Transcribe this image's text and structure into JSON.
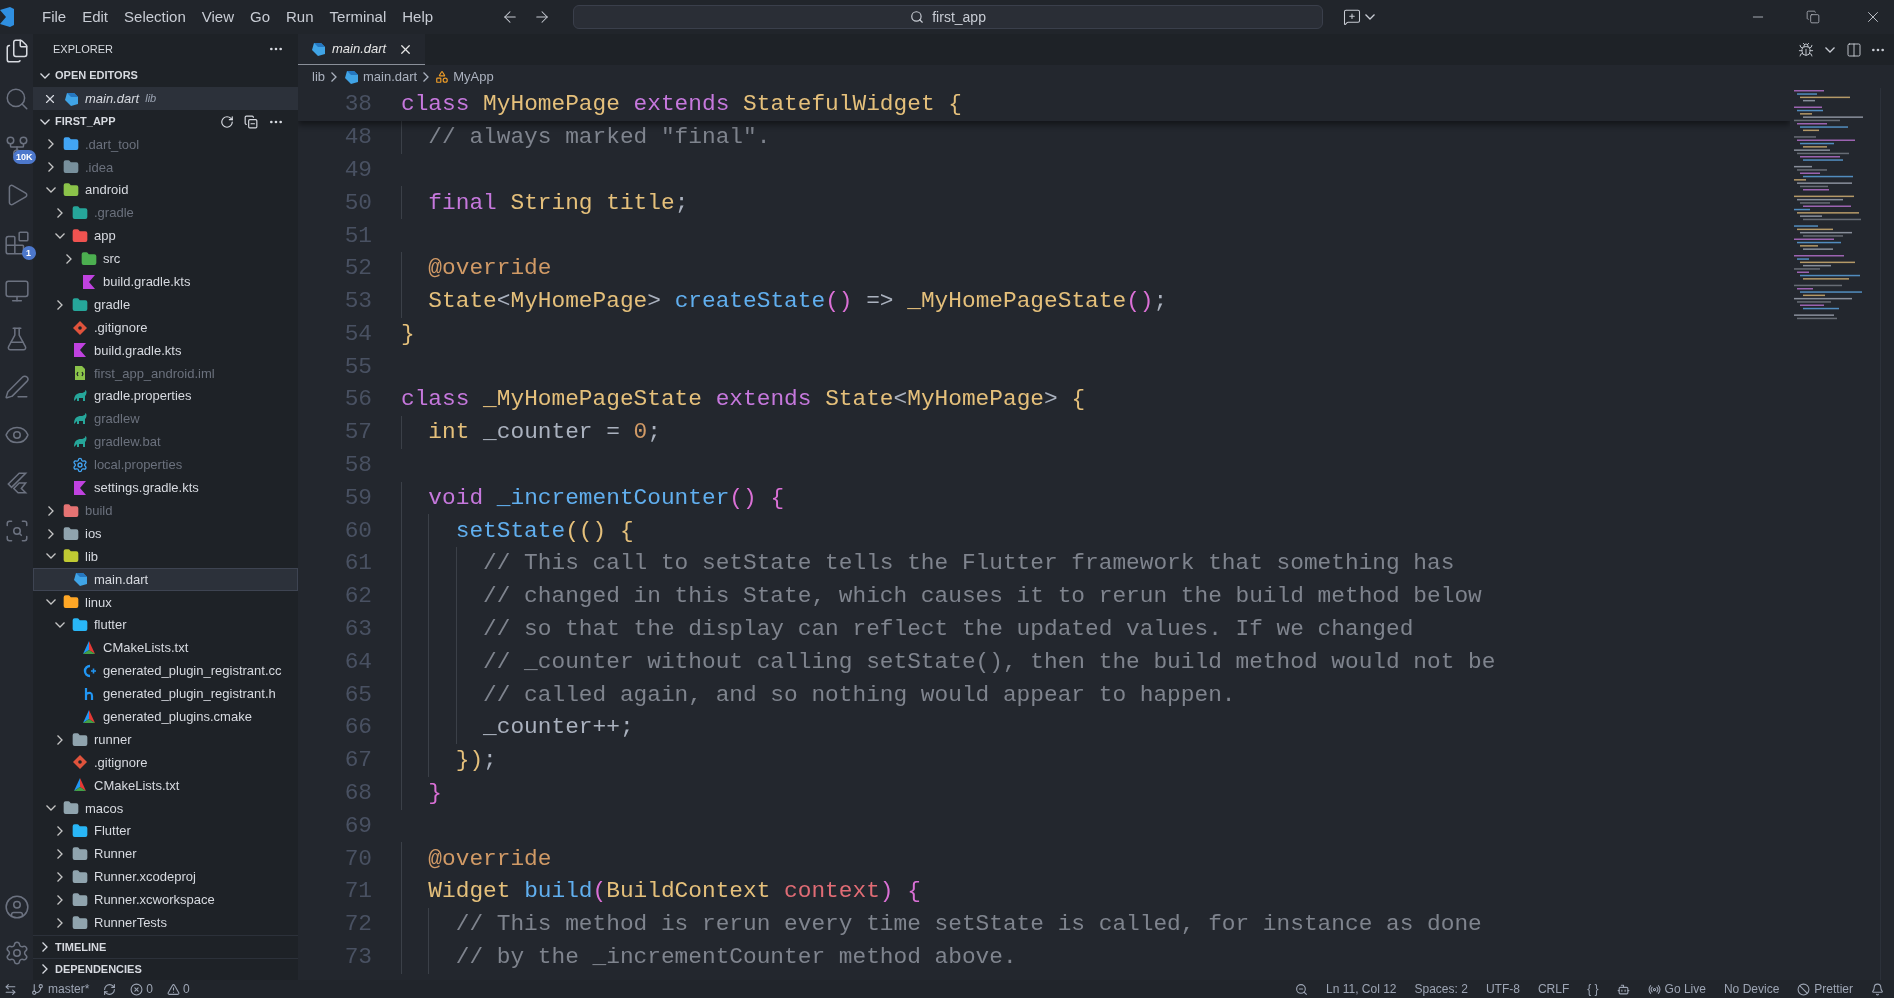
{
  "title_bar": {
    "menus": [
      "File",
      "Edit",
      "Selection",
      "View",
      "Go",
      "Run",
      "Terminal",
      "Help"
    ],
    "search": "first_app"
  },
  "activity_bar": {
    "items": [
      {
        "kind": "explorer",
        "selected": true
      },
      {
        "kind": "search",
        "selected": false
      },
      {
        "kind": "source_control",
        "selected": false,
        "badge": "10K"
      },
      {
        "kind": "run",
        "selected": false
      },
      {
        "kind": "extensions",
        "selected": false,
        "badge": "1"
      },
      {
        "kind": "remote",
        "selected": false
      },
      {
        "kind": "testing",
        "selected": false
      },
      {
        "kind": "pen",
        "selected": false
      },
      {
        "kind": "preview",
        "selected": false
      },
      {
        "kind": "flutter",
        "selected": false
      },
      {
        "kind": "scan",
        "selected": false
      }
    ],
    "bottom": [
      {
        "kind": "account"
      },
      {
        "kind": "settings"
      }
    ]
  },
  "sidebar": {
    "title": "EXPLORER",
    "open_editors": {
      "label": "OPEN EDITORS",
      "expanded": true,
      "items": [
        {
          "name": "main.dart",
          "description": "lib",
          "kind": "dart"
        }
      ]
    },
    "project": {
      "label": "FIRST_APP",
      "expanded": true,
      "tree": [
        {
          "name": ".dart_tool",
          "kind": "folder",
          "color": "#42a5f5",
          "expanded": false,
          "selected": false,
          "dimmed": true
        },
        {
          "name": ".idea",
          "kind": "folder",
          "color": "#78909c",
          "expanded": false,
          "selected": false,
          "dimmed": true
        },
        {
          "name": "android",
          "kind": "folder",
          "color": "#8bc34a",
          "expanded": true,
          "selected": false,
          "dimmed": false,
          "children": [
            {
              "name": ".gradle",
              "kind": "folder",
              "color": "#26a69a",
              "expanded": false,
              "selected": false,
              "dimmed": true
            },
            {
              "name": "app",
              "kind": "folder",
              "color": "#ef5350",
              "expanded": true,
              "selected": false,
              "dimmed": false,
              "children": [
                {
                  "name": "src",
                  "kind": "folder",
                  "color": "#4caf50",
                  "expanded": false,
                  "selected": false,
                  "dimmed": false
                },
                {
                  "name": "build.gradle.kts",
                  "kind": "kotlin",
                  "selected": false,
                  "dimmed": false
                }
              ]
            },
            {
              "name": "gradle",
              "kind": "folder",
              "color": "#26a69a",
              "expanded": false,
              "selected": false,
              "dimmed": false
            },
            {
              "name": ".gitignore",
              "kind": "git",
              "selected": false,
              "dimmed": false
            },
            {
              "name": "build.gradle.kts",
              "kind": "kotlin",
              "selected": false,
              "dimmed": false
            },
            {
              "name": "first_app_android.iml",
              "kind": "iml",
              "selected": false,
              "dimmed": true
            },
            {
              "name": "gradle.properties",
              "kind": "gradle",
              "selected": false,
              "dimmed": false
            },
            {
              "name": "gradlew",
              "kind": "gradle",
              "selected": false,
              "dimmed": true
            },
            {
              "name": "gradlew.bat",
              "kind": "gradle",
              "selected": false,
              "dimmed": true
            },
            {
              "name": "local.properties",
              "kind": "gear",
              "selected": false,
              "dimmed": true
            },
            {
              "name": "settings.gradle.kts",
              "kind": "kotlin",
              "selected": false,
              "dimmed": false
            }
          ]
        },
        {
          "name": "build",
          "kind": "folder",
          "color": "#e57373",
          "expanded": false,
          "selected": false,
          "dimmed": true
        },
        {
          "name": "ios",
          "kind": "folder",
          "color": "#90a4ae",
          "expanded": false,
          "selected": false,
          "dimmed": false
        },
        {
          "name": "lib",
          "kind": "folder",
          "color": "#c0ca33",
          "expanded": true,
          "selected": false,
          "dimmed": false,
          "children": [
            {
              "name": "main.dart",
              "kind": "dart",
              "selected": true,
              "dimmed": false
            }
          ]
        },
        {
          "name": "linux",
          "kind": "folder",
          "color": "#ffa726",
          "expanded": true,
          "selected": false,
          "dimmed": false,
          "children": [
            {
              "name": "flutter",
              "kind": "folder",
              "color": "#29b6f6",
              "expanded": true,
              "selected": false,
              "dimmed": false,
              "children": [
                {
                  "name": "CMakeLists.txt",
                  "kind": "cmake",
                  "selected": false,
                  "dimmed": false
                },
                {
                  "name": "generated_plugin_registrant.cc",
                  "kind": "cpp",
                  "selected": false,
                  "dimmed": false
                },
                {
                  "name": "generated_plugin_registrant.h",
                  "kind": "h",
                  "selected": false,
                  "dimmed": false
                },
                {
                  "name": "generated_plugins.cmake",
                  "kind": "cmake",
                  "selected": false,
                  "dimmed": false
                }
              ]
            },
            {
              "name": "runner",
              "kind": "folder",
              "color": "#90a4ae",
              "expanded": false,
              "selected": false,
              "dimmed": false
            },
            {
              "name": ".gitignore",
              "kind": "git",
              "selected": false,
              "dimmed": false
            },
            {
              "name": "CMakeLists.txt",
              "kind": "cmake",
              "selected": false,
              "dimmed": false
            }
          ]
        },
        {
          "name": "macos",
          "kind": "folder",
          "color": "#90a4ae",
          "expanded": true,
          "selected": false,
          "dimmed": false,
          "children": [
            {
              "name": "Flutter",
              "kind": "folder",
              "color": "#29b6f6",
              "expanded": false,
              "selected": false,
              "dimmed": false
            },
            {
              "name": "Runner",
              "kind": "folder",
              "color": "#90a4ae",
              "expanded": false,
              "selected": false,
              "dimmed": false
            },
            {
              "name": "Runner.xcodeproj",
              "kind": "folder",
              "color": "#90a4ae",
              "expanded": false,
              "selected": false,
              "dimmed": false
            },
            {
              "name": "Runner.xcworkspace",
              "kind": "folder",
              "color": "#90a4ae",
              "expanded": false,
              "selected": false,
              "dimmed": false
            },
            {
              "name": "RunnerTests",
              "kind": "folder",
              "color": "#90a4ae",
              "expanded": false,
              "selected": false,
              "dimmed": false
            }
          ]
        }
      ]
    },
    "sections": [
      {
        "label": "TIMELINE",
        "expanded": false
      },
      {
        "label": "DEPENDENCIES",
        "expanded": false
      }
    ]
  },
  "editor": {
    "tabs": [
      {
        "name": "main.dart",
        "kind": "dart",
        "selected": true,
        "preview": true
      }
    ],
    "breadcrumbs": [
      {
        "text": "lib",
        "kind": "folder"
      },
      {
        "text": "main.dart",
        "kind": "dart"
      },
      {
        "text": "MyApp",
        "kind": "class"
      }
    ],
    "sticky_line": {
      "number": "38",
      "tokens": [
        {
          "text": "class ",
          "kind": "keyword"
        },
        {
          "text": "MyHomePage ",
          "kind": "type"
        },
        {
          "text": "extends ",
          "kind": "keyword"
        },
        {
          "text": "StatefulWidget ",
          "kind": "type"
        },
        {
          "text": "{",
          "kind": "bracket1"
        }
      ]
    },
    "lines": [
      {
        "number": "48",
        "tokens": [
          {
            "text": "  // always marked \"final\".",
            "kind": "comment"
          }
        ]
      },
      {
        "number": "49"
      },
      {
        "number": "50",
        "tokens": [
          {
            "text": "  final ",
            "kind": "keyword"
          },
          {
            "text": "String ",
            "kind": "type"
          },
          {
            "text": "title",
            "kind": "variable"
          },
          {
            "text": ";",
            "kind": "plain"
          }
        ]
      },
      {
        "number": "51"
      },
      {
        "number": "52",
        "tokens": [
          {
            "text": "  @override",
            "kind": "annotation"
          }
        ]
      },
      {
        "number": "53",
        "tokens": [
          {
            "text": "  State",
            "kind": "type"
          },
          {
            "text": "<",
            "kind": "plain"
          },
          {
            "text": "MyHomePage",
            "kind": "type"
          },
          {
            "text": "> ",
            "kind": "plain"
          },
          {
            "text": "createState",
            "kind": "function"
          },
          {
            "text": "()",
            "kind": "bracket2"
          },
          {
            "text": " => ",
            "kind": "plain"
          },
          {
            "text": "_MyHomePageState",
            "kind": "type"
          },
          {
            "text": "()",
            "kind": "bracket2"
          },
          {
            "text": ";",
            "kind": "plain"
          }
        ]
      },
      {
        "number": "54",
        "tokens": [
          {
            "text": "}",
            "kind": "bracket1"
          }
        ]
      },
      {
        "number": "55"
      },
      {
        "number": "56",
        "tokens": [
          {
            "text": "class ",
            "kind": "keyword"
          },
          {
            "text": "_MyHomePageState ",
            "kind": "type"
          },
          {
            "text": "extends ",
            "kind": "keyword"
          },
          {
            "text": "State",
            "kind": "type"
          },
          {
            "text": "<",
            "kind": "plain"
          },
          {
            "text": "MyHomePage",
            "kind": "type"
          },
          {
            "text": "> ",
            "kind": "plain"
          },
          {
            "text": "{",
            "kind": "bracket1"
          }
        ]
      },
      {
        "number": "57",
        "tokens": [
          {
            "text": "  int ",
            "kind": "type"
          },
          {
            "text": "_counter = ",
            "kind": "plain"
          },
          {
            "text": "0",
            "kind": "number"
          },
          {
            "text": ";",
            "kind": "plain"
          }
        ]
      },
      {
        "number": "58"
      },
      {
        "number": "59",
        "tokens": [
          {
            "text": "  void ",
            "kind": "keyword"
          },
          {
            "text": "_incrementCounter",
            "kind": "function"
          },
          {
            "text": "() {",
            "kind": "bracket2"
          }
        ]
      },
      {
        "number": "60",
        "tokens": [
          {
            "text": "    setState",
            "kind": "function"
          },
          {
            "text": "(() {",
            "kind": "bracket1"
          }
        ]
      },
      {
        "number": "61",
        "tokens": [
          {
            "text": "      // This call to setState tells the Flutter framework that something has",
            "kind": "comment"
          }
        ]
      },
      {
        "number": "62",
        "tokens": [
          {
            "text": "      // changed in this State, which causes it to rerun the build method below",
            "kind": "comment"
          }
        ]
      },
      {
        "number": "63",
        "tokens": [
          {
            "text": "      // so that the display can reflect the updated values. If we changed",
            "kind": "comment"
          }
        ]
      },
      {
        "number": "64",
        "tokens": [
          {
            "text": "      // _counter without calling setState(), then the build method would not be",
            "kind": "comment"
          }
        ]
      },
      {
        "number": "65",
        "tokens": [
          {
            "text": "      // called again, and so nothing would appear to happen.",
            "kind": "comment"
          }
        ]
      },
      {
        "number": "66",
        "tokens": [
          {
            "text": "      _counter++;",
            "kind": "plain"
          }
        ]
      },
      {
        "number": "67",
        "tokens": [
          {
            "text": "    })",
            "kind": "bracket1"
          },
          {
            "text": ";",
            "kind": "plain"
          }
        ]
      },
      {
        "number": "68",
        "tokens": [
          {
            "text": "  }",
            "kind": "bracket2"
          }
        ]
      },
      {
        "number": "69"
      },
      {
        "number": "70",
        "tokens": [
          {
            "text": "  @override",
            "kind": "annotation"
          }
        ]
      },
      {
        "number": "71",
        "tokens": [
          {
            "text": "  Widget ",
            "kind": "type"
          },
          {
            "text": "build",
            "kind": "function"
          },
          {
            "text": "(",
            "kind": "bracket2"
          },
          {
            "text": "BuildContext ",
            "kind": "type"
          },
          {
            "text": "context",
            "kind": "parameter"
          },
          {
            "text": ") {",
            "kind": "bracket2"
          }
        ]
      },
      {
        "number": "72",
        "tokens": [
          {
            "text": "    // This method is rerun every time setState is called, for instance as done",
            "kind": "comment"
          }
        ]
      },
      {
        "number": "73",
        "tokens": [
          {
            "text": "    // by the _incrementCounter method above.",
            "kind": "comment"
          }
        ]
      }
    ]
  },
  "status_bar": {
    "left": [
      {
        "kind": "remote"
      },
      {
        "kind": "branch",
        "text": "master*"
      },
      {
        "kind": "sync"
      },
      {
        "kind": "errors",
        "text": "0"
      },
      {
        "kind": "warnings",
        "text": "0"
      }
    ],
    "right": [
      {
        "kind": "zoom"
      },
      {
        "kind": "text",
        "text": "Ln 11, Col 12"
      },
      {
        "kind": "text",
        "text": "Spaces: 2"
      },
      {
        "kind": "text",
        "text": "UTF-8"
      },
      {
        "kind": "text",
        "text": "CRLF"
      },
      {
        "kind": "text",
        "text": "{ }"
      },
      {
        "kind": "copilot"
      },
      {
        "kind": "live",
        "text": "Go Live"
      },
      {
        "kind": "text",
        "text": "No Device"
      },
      {
        "kind": "prettier",
        "text": "Prettier"
      },
      {
        "kind": "bell"
      }
    ]
  }
}
